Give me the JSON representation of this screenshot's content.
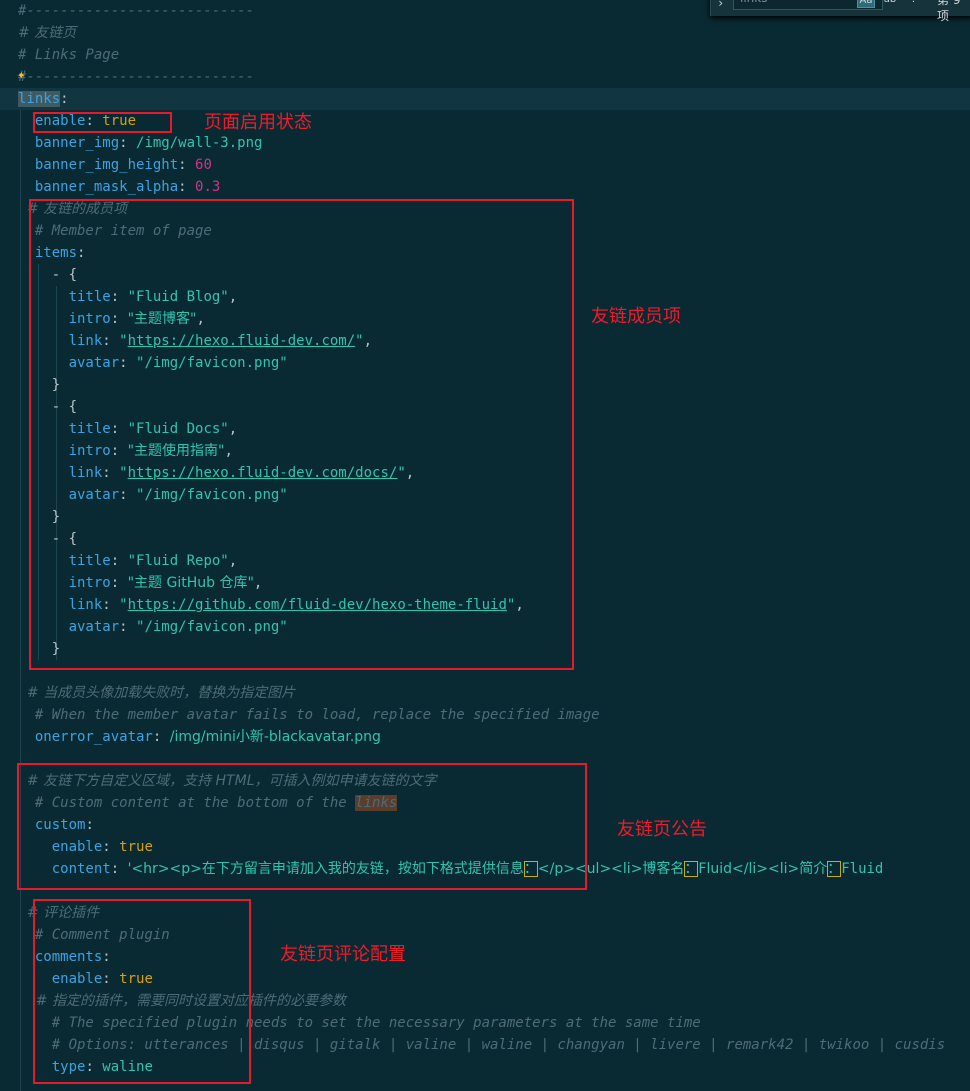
{
  "find_widget": {
    "query": "links",
    "match_case_label": "Aa",
    "whole_word_label": "ab",
    "regex_label": ".*",
    "count_text": "第 9 项"
  },
  "editor": {
    "lines": [
      {
        "hl": false,
        "tokens": [
          [
            "c",
            "#---------------------------"
          ]
        ]
      },
      {
        "hl": false,
        "tokens": [
          [
            "c",
            "# 友链页"
          ]
        ]
      },
      {
        "hl": false,
        "tokens": [
          [
            "c",
            "# Links Page"
          ]
        ]
      },
      {
        "hl": false,
        "tokens": [
          [
            "c",
            "#---------------------------"
          ]
        ]
      },
      {
        "hl": true,
        "tokens": [
          [
            "k sel",
            "links"
          ],
          [
            "p",
            ":"
          ]
        ]
      },
      {
        "hl": false,
        "tokens": [
          [
            "p",
            "  "
          ],
          [
            "k",
            "enable"
          ],
          [
            "p",
            ": "
          ],
          [
            "b",
            "true"
          ]
        ]
      },
      {
        "hl": false,
        "tokens": [
          [
            "p",
            "  "
          ],
          [
            "k",
            "banner_img"
          ],
          [
            "p",
            ": "
          ],
          [
            "s",
            "/img/wall-3.png"
          ]
        ]
      },
      {
        "hl": false,
        "tokens": [
          [
            "p",
            "  "
          ],
          [
            "k",
            "banner_img_height"
          ],
          [
            "p",
            ": "
          ],
          [
            "n",
            "60"
          ]
        ]
      },
      {
        "hl": false,
        "tokens": [
          [
            "p",
            "  "
          ],
          [
            "k",
            "banner_mask_alpha"
          ],
          [
            "p",
            ": "
          ],
          [
            "n",
            "0.3"
          ]
        ]
      },
      {
        "hl": false,
        "tokens": [
          [
            "c",
            "  # 友链的成员项"
          ]
        ]
      },
      {
        "hl": false,
        "tokens": [
          [
            "c",
            "  # Member item of page"
          ]
        ]
      },
      {
        "hl": false,
        "tokens": [
          [
            "p",
            "  "
          ],
          [
            "k",
            "items"
          ],
          [
            "p",
            ":"
          ]
        ]
      },
      {
        "hl": false,
        "tokens": [
          [
            "p",
            "    - {"
          ]
        ]
      },
      {
        "hl": false,
        "tokens": [
          [
            "p",
            "      "
          ],
          [
            "k",
            "title"
          ],
          [
            "p",
            ": "
          ],
          [
            "s",
            "\"Fluid Blog\""
          ],
          [
            "p",
            ","
          ]
        ]
      },
      {
        "hl": false,
        "tokens": [
          [
            "p",
            "      "
          ],
          [
            "k",
            "intro"
          ],
          [
            "p",
            ": "
          ],
          [
            "s",
            "\"主题博客\""
          ],
          [
            "p",
            ","
          ]
        ]
      },
      {
        "hl": false,
        "tokens": [
          [
            "p",
            "      "
          ],
          [
            "k",
            "link"
          ],
          [
            "p",
            ": "
          ],
          [
            "s",
            "\""
          ],
          [
            "s u",
            "https://hexo.fluid-dev.com/"
          ],
          [
            "s",
            "\""
          ],
          [
            "p",
            ","
          ]
        ]
      },
      {
        "hl": false,
        "tokens": [
          [
            "p",
            "      "
          ],
          [
            "k",
            "avatar"
          ],
          [
            "p",
            ": "
          ],
          [
            "s",
            "\"/img/favicon.png\""
          ]
        ]
      },
      {
        "hl": false,
        "tokens": [
          [
            "p",
            "    }"
          ]
        ]
      },
      {
        "hl": false,
        "tokens": [
          [
            "p",
            "    - {"
          ]
        ]
      },
      {
        "hl": false,
        "tokens": [
          [
            "p",
            "      "
          ],
          [
            "k",
            "title"
          ],
          [
            "p",
            ": "
          ],
          [
            "s",
            "\"Fluid Docs\""
          ],
          [
            "p",
            ","
          ]
        ]
      },
      {
        "hl": false,
        "tokens": [
          [
            "p",
            "      "
          ],
          [
            "k",
            "intro"
          ],
          [
            "p",
            ": "
          ],
          [
            "s",
            "\"主题使用指南\""
          ],
          [
            "p",
            ","
          ]
        ]
      },
      {
        "hl": false,
        "tokens": [
          [
            "p",
            "      "
          ],
          [
            "k",
            "link"
          ],
          [
            "p",
            ": "
          ],
          [
            "s",
            "\""
          ],
          [
            "s u",
            "https://hexo.fluid-dev.com/docs/"
          ],
          [
            "s",
            "\""
          ],
          [
            "p",
            ","
          ]
        ]
      },
      {
        "hl": false,
        "tokens": [
          [
            "p",
            "      "
          ],
          [
            "k",
            "avatar"
          ],
          [
            "p",
            ": "
          ],
          [
            "s",
            "\"/img/favicon.png\""
          ]
        ]
      },
      {
        "hl": false,
        "tokens": [
          [
            "p",
            "    }"
          ]
        ]
      },
      {
        "hl": false,
        "tokens": [
          [
            "p",
            "    - {"
          ]
        ]
      },
      {
        "hl": false,
        "tokens": [
          [
            "p",
            "      "
          ],
          [
            "k",
            "title"
          ],
          [
            "p",
            ": "
          ],
          [
            "s",
            "\"Fluid Repo\""
          ],
          [
            "p",
            ","
          ]
        ]
      },
      {
        "hl": false,
        "tokens": [
          [
            "p",
            "      "
          ],
          [
            "k",
            "intro"
          ],
          [
            "p",
            ": "
          ],
          [
            "s",
            "\"主题 GitHub 仓库\""
          ],
          [
            "p",
            ","
          ]
        ]
      },
      {
        "hl": false,
        "tokens": [
          [
            "p",
            "      "
          ],
          [
            "k",
            "link"
          ],
          [
            "p",
            ": "
          ],
          [
            "s",
            "\""
          ],
          [
            "s u",
            "https://github.com/fluid-dev/hexo-theme-fluid"
          ],
          [
            "s",
            "\""
          ],
          [
            "p",
            ","
          ]
        ]
      },
      {
        "hl": false,
        "tokens": [
          [
            "p",
            "      "
          ],
          [
            "k",
            "avatar"
          ],
          [
            "p",
            ": "
          ],
          [
            "s",
            "\"/img/favicon.png\""
          ]
        ]
      },
      {
        "hl": false,
        "tokens": [
          [
            "p",
            "    }"
          ]
        ]
      },
      {
        "hl": false,
        "tokens": [
          [
            "p",
            ""
          ]
        ]
      },
      {
        "hl": false,
        "tokens": [
          [
            "c",
            "  # 当成员头像加载失败时，替换为指定图片"
          ]
        ]
      },
      {
        "hl": false,
        "tokens": [
          [
            "c",
            "  # When the member avatar fails to load, replace the specified image"
          ]
        ]
      },
      {
        "hl": false,
        "tokens": [
          [
            "p",
            "  "
          ],
          [
            "k",
            "onerror_avatar"
          ],
          [
            "p",
            ": "
          ],
          [
            "s",
            "/img/mini小新-blackavatar.png"
          ]
        ]
      },
      {
        "hl": false,
        "tokens": [
          [
            "p",
            ""
          ]
        ]
      },
      {
        "hl": false,
        "tokens": [
          [
            "c",
            "  # 友链下方自定义区域，支持 HTML，可插入例如申请友链的文字"
          ]
        ]
      },
      {
        "hl": false,
        "tokens": [
          [
            "c",
            "  # Custom content at the bottom of the "
          ],
          [
            "c findhl",
            "links"
          ]
        ]
      },
      {
        "hl": false,
        "tokens": [
          [
            "p",
            "  "
          ],
          [
            "k",
            "custom"
          ],
          [
            "p",
            ":"
          ]
        ]
      },
      {
        "hl": false,
        "tokens": [
          [
            "p",
            "    "
          ],
          [
            "k",
            "enable"
          ],
          [
            "p",
            ": "
          ],
          [
            "b",
            "true"
          ]
        ]
      },
      {
        "hl": false,
        "tokens": [
          [
            "p",
            "    "
          ],
          [
            "k",
            "content"
          ],
          [
            "p",
            ": "
          ],
          [
            "s",
            "'<hr><p>在下方留言申请加入我的友链，按如下格式提供信息"
          ],
          [
            "s m",
            "："
          ],
          [
            "s",
            "</p><ul><li>博客名"
          ],
          [
            "s m",
            "："
          ],
          [
            "s",
            "Fluid</li><li>简介"
          ],
          [
            "s m",
            "："
          ],
          [
            "s",
            "Fluid"
          ]
        ]
      },
      {
        "hl": false,
        "tokens": [
          [
            "p",
            ""
          ]
        ]
      },
      {
        "hl": false,
        "tokens": [
          [
            "c",
            "  # 评论插件"
          ]
        ]
      },
      {
        "hl": false,
        "tokens": [
          [
            "c",
            "  # Comment plugin"
          ]
        ]
      },
      {
        "hl": false,
        "tokens": [
          [
            "p",
            "  "
          ],
          [
            "k",
            "comments"
          ],
          [
            "p",
            ":"
          ]
        ]
      },
      {
        "hl": false,
        "tokens": [
          [
            "p",
            "    "
          ],
          [
            "k",
            "enable"
          ],
          [
            "p",
            ": "
          ],
          [
            "b",
            "true"
          ]
        ]
      },
      {
        "hl": false,
        "tokens": [
          [
            "c",
            "    # 指定的插件，需要同时设置对应插件的必要参数"
          ]
        ]
      },
      {
        "hl": false,
        "tokens": [
          [
            "c",
            "    # The specified plugin needs to set the necessary parameters at the same time"
          ]
        ]
      },
      {
        "hl": false,
        "tokens": [
          [
            "c",
            "    # Options: utterances | disqus | gitalk | valine | waline | changyan | livere | remark42 | twikoo | cusdis"
          ]
        ]
      },
      {
        "hl": false,
        "tokens": [
          [
            "p",
            "    "
          ],
          [
            "k",
            "type"
          ],
          [
            "p",
            ": "
          ],
          [
            "s",
            "waline"
          ]
        ]
      }
    ]
  },
  "annotations": {
    "enable_label": "页面启用状态",
    "members_label": "友链成员项",
    "notice_label": "友链页公告",
    "comments_label": "友链页评论配置"
  }
}
